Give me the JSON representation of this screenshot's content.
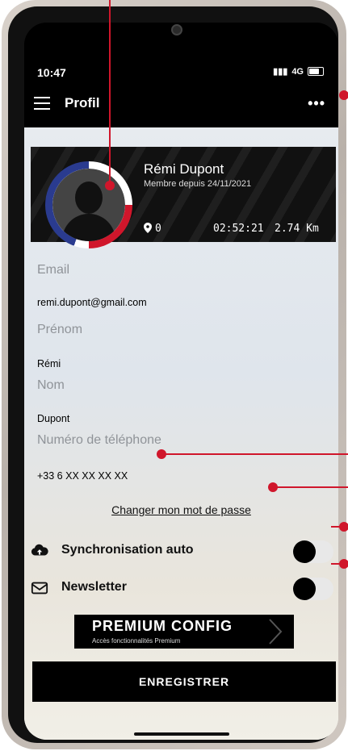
{
  "status_bar": {
    "time": "10:47",
    "signal": "4G",
    "battery_level": 0.75
  },
  "header": {
    "title": "Profil",
    "more": "•••"
  },
  "profile": {
    "name": "Rémi Dupont",
    "member_since": "Membre depuis 24/11/2021",
    "stats": {
      "count": "0",
      "duration": "02:52:21",
      "distance": "2.74 Km"
    }
  },
  "form": {
    "email_label": "Email",
    "email_value": "remi.dupont@gmail.com",
    "firstname_label": "Prénom",
    "firstname_value": "Rémi",
    "lastname_label": "Nom",
    "lastname_value": "Dupont",
    "phone_label": "Numéro de téléphone",
    "phone_value": "+33 6 XX XX XX XX"
  },
  "change_password": "Changer mon mot de passe",
  "toggles": [
    {
      "label": "Synchronisation auto",
      "on": false
    },
    {
      "label": "Newsletter",
      "on": false
    }
  ],
  "premium": {
    "title": "PREMIUM CONFIG",
    "subtitle": "Accès fonctionnalités Premium"
  },
  "save_button": "ENREGISTRER",
  "colors": {
    "accent_red": "#d0162b",
    "flag_blue": "#2a3b8f"
  }
}
